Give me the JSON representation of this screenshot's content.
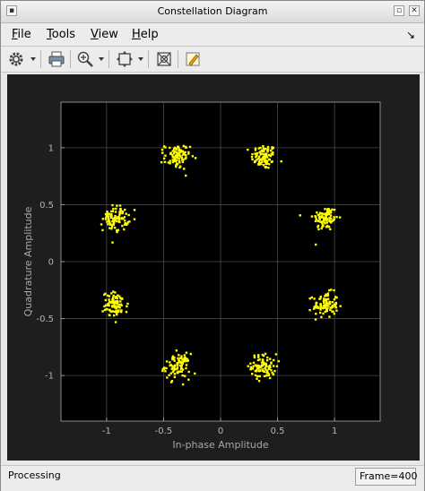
{
  "window": {
    "title": "Constellation Diagram"
  },
  "menubar": {
    "items": [
      "File",
      "Tools",
      "View",
      "Help"
    ],
    "underline_first": [
      true,
      true,
      true,
      true
    ],
    "dock_icon": "undock-arrow-icon"
  },
  "toolbar": {
    "buttons": [
      {
        "name": "settings-button",
        "icon": "gear-icon",
        "dropdown": true
      },
      {
        "name": "print-button",
        "icon": "printer-icon",
        "dropdown": false
      },
      {
        "name": "zoom-button",
        "icon": "zoom-in-icon",
        "dropdown": true
      },
      {
        "name": "scale-axes-button",
        "icon": "scale-axes-icon",
        "dropdown": true
      },
      {
        "name": "measurements-button",
        "icon": "signal-cursor-icon",
        "dropdown": false
      },
      {
        "name": "style-button",
        "icon": "highlight-pen-icon",
        "dropdown": false
      }
    ]
  },
  "status": {
    "left": "Processing",
    "frame": "Frame=400"
  },
  "colors": {
    "scope_background": "#1e1e1e",
    "axes_background": "#000000",
    "grid": "#4a4a4a",
    "points": "#ffff00"
  },
  "chart_data": {
    "type": "scatter",
    "title": "",
    "xlabel": "In-phase Amplitude",
    "ylabel": "Quadrature Amplitude",
    "xlim": [
      -1.4,
      1.4
    ],
    "ylim": [
      -1.4,
      1.4
    ],
    "xticks": [
      -1,
      -0.5,
      0,
      0.5,
      1
    ],
    "yticks": [
      -1,
      -0.5,
      0,
      0.5,
      1
    ],
    "xtick_labels": [
      "-1",
      "-0.5",
      "0",
      "0.5",
      "1"
    ],
    "ytick_labels": [
      "-1",
      "-0.5",
      "0",
      "0.5",
      "1"
    ],
    "grid": true,
    "constellation": "8-PSK",
    "cluster_centers": [
      [
        0.38,
        0.92
      ],
      [
        0.92,
        0.38
      ],
      [
        0.92,
        -0.38
      ],
      [
        0.38,
        -0.92
      ],
      [
        -0.38,
        -0.92
      ],
      [
        -0.92,
        -0.38
      ],
      [
        -0.92,
        0.38
      ],
      [
        -0.38,
        0.92
      ]
    ],
    "points_per_cluster": 90,
    "noise_std": 0.055
  }
}
